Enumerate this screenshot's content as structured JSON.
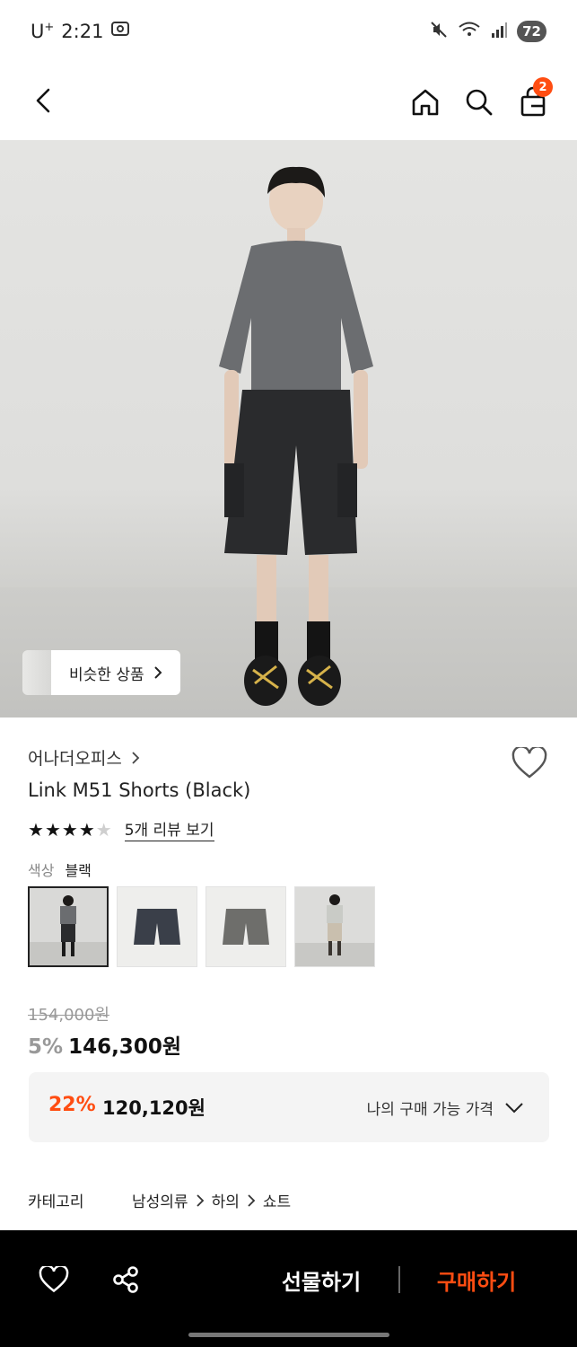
{
  "status_bar": {
    "carrier": "U",
    "carrier_sup": "+",
    "time": "2:21",
    "battery": "72"
  },
  "header": {
    "cart_count": "2"
  },
  "hero": {
    "similar_label": "비슷한 상품"
  },
  "product": {
    "brand": "어나더오피스",
    "title": "Link M51 Shorts (Black)",
    "rating": 4,
    "rating_max": 5,
    "review_link": "5개 리뷰 보기",
    "color_label": "색상",
    "color_value": "블랙",
    "swatches": [
      "model-black",
      "navy-shorts",
      "gray-shorts",
      "model-beige"
    ]
  },
  "price": {
    "original": "154,000원",
    "discount_pct": "5%",
    "sale": "146,300원",
    "member_pct": "22%",
    "member_price": "120,120원",
    "member_label": "나의 구매 가능 가격"
  },
  "category": {
    "label": "카테고리",
    "crumbs": [
      "남성의류",
      "하의",
      "쇼트"
    ]
  },
  "action_bar": {
    "gift_label": "선물하기",
    "buy_label": "구매하기"
  },
  "colors": {
    "accent": "#ff4d12",
    "bar_bg": "#000000"
  }
}
